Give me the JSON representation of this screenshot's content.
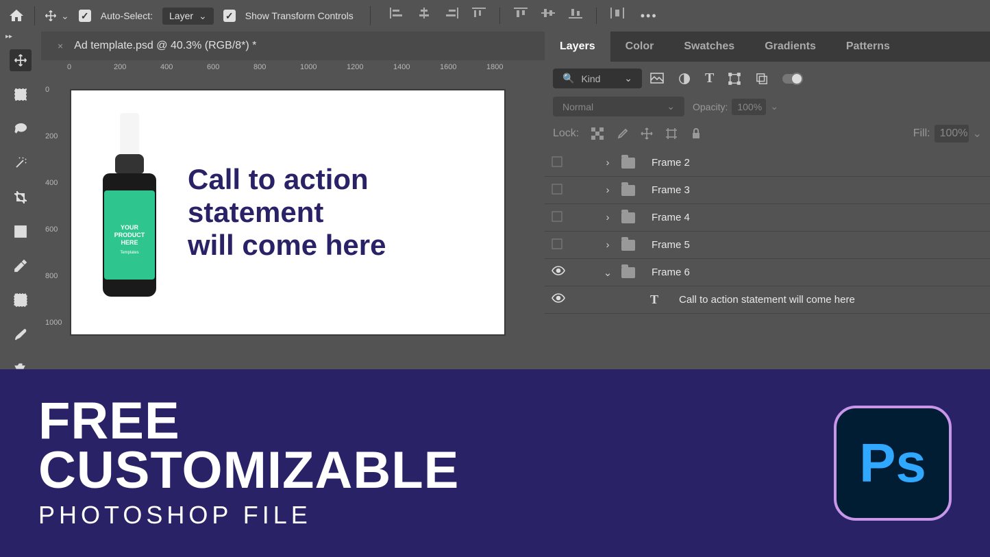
{
  "options": {
    "auto_select_label": "Auto-Select:",
    "layer_dd": "Layer",
    "show_transform": "Show Transform Controls"
  },
  "tab": {
    "title": "Ad template.psd @ 40.3% (RGB/8*) *"
  },
  "ruler_h": [
    "0",
    "200",
    "400",
    "600",
    "800",
    "1000",
    "1200",
    "1400",
    "1600",
    "1800"
  ],
  "ruler_v": [
    "0",
    "200",
    "400",
    "600",
    "800",
    "1000"
  ],
  "canvas": {
    "label_line1": "YOUR",
    "label_line2": "PRODUCT",
    "label_line3": "HERE",
    "label_sub": "Templates",
    "cta_line1": "Call to action",
    "cta_line2": "statement",
    "cta_line3": "will come here"
  },
  "panels": {
    "tabs": [
      "Layers",
      "Color",
      "Swatches",
      "Gradients",
      "Patterns"
    ],
    "kind": "Kind",
    "blend_mode": "Normal",
    "opacity_label": "Opacity:",
    "opacity_val": "100%",
    "lock_label": "Lock:",
    "fill_label": "Fill:",
    "fill_val": "100%"
  },
  "layers": [
    {
      "name": "Frame 2",
      "visible": false,
      "open": false,
      "type": "folder"
    },
    {
      "name": "Frame 3",
      "visible": false,
      "open": false,
      "type": "folder"
    },
    {
      "name": "Frame 4",
      "visible": false,
      "open": false,
      "type": "folder"
    },
    {
      "name": "Frame 5",
      "visible": false,
      "open": false,
      "type": "folder"
    },
    {
      "name": "Frame 6",
      "visible": true,
      "open": true,
      "type": "folder"
    },
    {
      "name": "Call to action statement will come here",
      "visible": true,
      "type": "text",
      "indent": true
    }
  ],
  "promo": {
    "line1": "FREE",
    "line2": "CUSTOMIZABLE",
    "line3": "PHOTOSHOP FILE",
    "logo": "Ps"
  }
}
